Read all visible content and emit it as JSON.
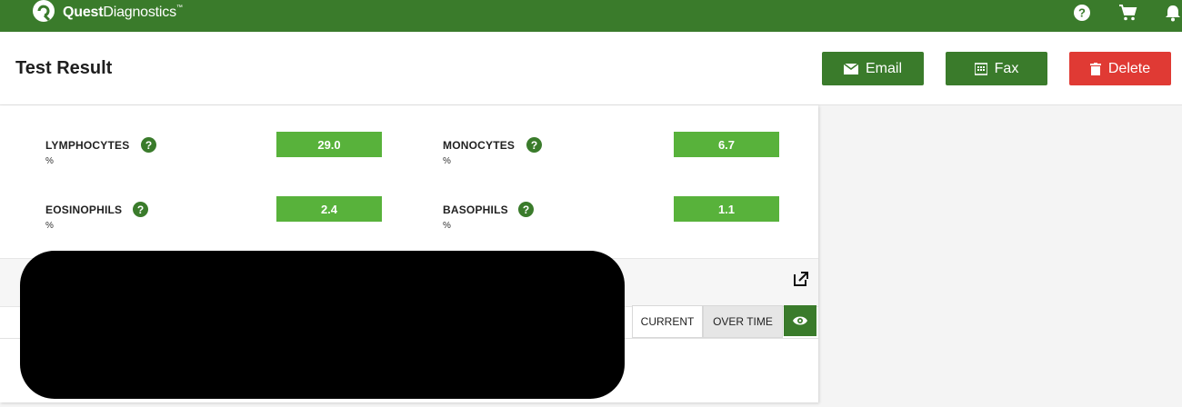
{
  "brand": {
    "name_bold": "Quest",
    "name_light": "Diagnostics",
    "trademark": "™"
  },
  "header": {
    "title": "Test Result"
  },
  "actions": {
    "email_label": "Email",
    "fax_label": "Fax",
    "delete_label": "Delete"
  },
  "results": [
    {
      "name": "LYMPHOCYTES",
      "unit": "%",
      "value": "29.0"
    },
    {
      "name": "MONOCYTES",
      "unit": "%",
      "value": "6.7"
    },
    {
      "name": "EOSINOPHILS",
      "unit": "%",
      "value": "2.4"
    },
    {
      "name": "BASOPHILS",
      "unit": "%",
      "value": "1.1"
    }
  ],
  "view_tabs": {
    "current": "CURRENT",
    "over_time": "OVER TIME"
  },
  "icons": {
    "top": [
      "help-circle-icon",
      "cart-icon",
      "bell-icon"
    ],
    "help": "?"
  },
  "colors": {
    "brand_green": "#3a7b2b",
    "value_green": "#58b23b",
    "delete_red": "#e03a34"
  }
}
